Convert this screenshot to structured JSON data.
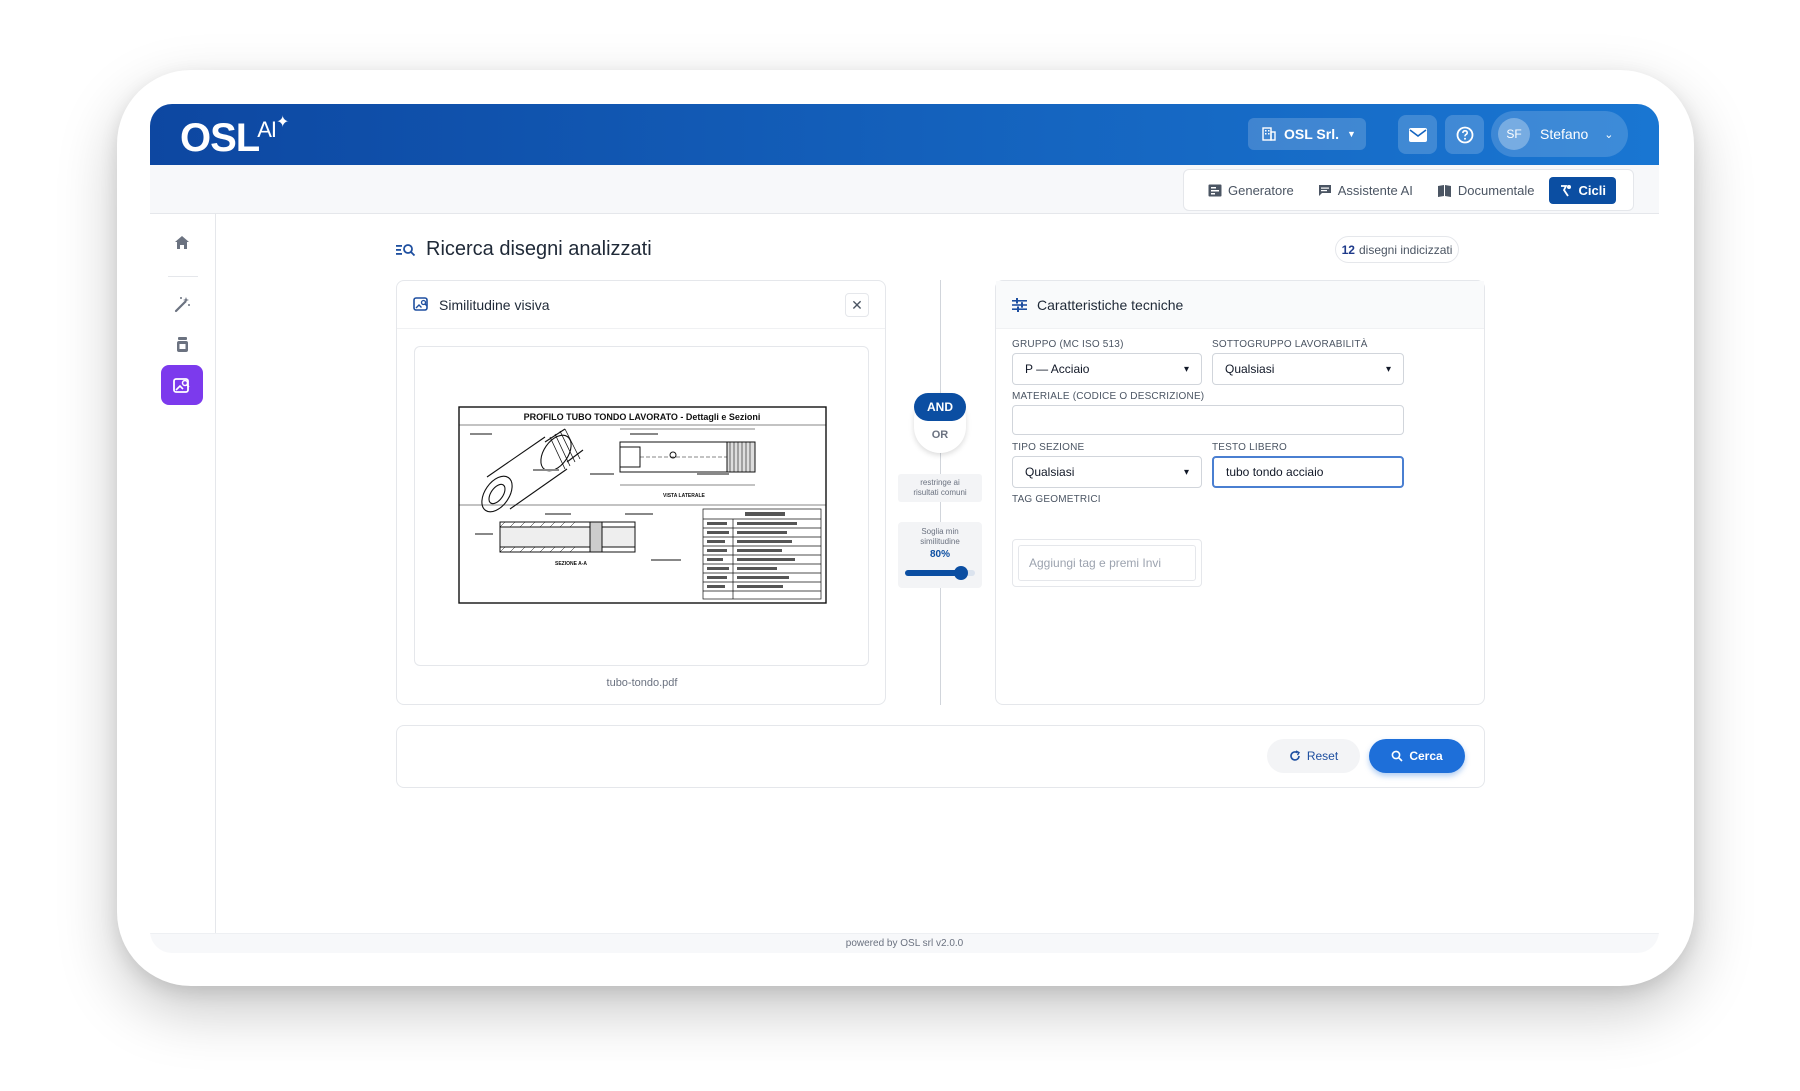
{
  "app": {
    "logo_text": "OSL",
    "logo_ai": "AI"
  },
  "header": {
    "company": "OSL Srl.",
    "user_initials": "SF",
    "user_name": "Stefano"
  },
  "subnav": {
    "items": [
      {
        "label": "Generatore",
        "icon": "generator-icon"
      },
      {
        "label": "Assistente AI",
        "icon": "chat-icon"
      },
      {
        "label": "Documentale",
        "icon": "book-icon"
      },
      {
        "label": "Cicli",
        "icon": "lathe-icon",
        "active": true
      }
    ]
  },
  "sidebar": {
    "items": [
      {
        "icon": "home-icon"
      },
      {
        "icon": "magic-wand-icon"
      },
      {
        "icon": "jar-icon"
      },
      {
        "icon": "image-search-icon",
        "active": true
      }
    ]
  },
  "page": {
    "title": "Ricerca disegni analizzati",
    "index_count": "12",
    "index_label": "disegni indicizzati"
  },
  "visual": {
    "title": "Similitudine visiva",
    "filename": "tubo-tondo.pdf",
    "drawing_title": "PROFILO TUBO TONDO LAVORATO - Dettagli e Sezioni"
  },
  "connector": {
    "and_label": "AND",
    "or_label": "OR",
    "restrict_line1": "restringe ai",
    "restrict_line2": "risultati comuni",
    "threshold_line1": "Soglia min",
    "threshold_line2": "similitudine",
    "threshold_value": "80%",
    "threshold_fraction": 0.8
  },
  "tech": {
    "title": "Caratteristiche tecniche",
    "group_label": "Gruppo (MC ISO 513)",
    "group_value": "P — Acciaio",
    "subgroup_label": "Sottogruppo lavorabilità",
    "subgroup_value": "Qualsiasi",
    "material_label": "Materiale (codice o descrizione)",
    "material_value": "",
    "section_label": "Tipo sezione",
    "section_value": "Qualsiasi",
    "freetext_label": "Testo libero",
    "freetext_value": "tubo tondo acciaio",
    "tags_label": "Tag geometrici",
    "tags_placeholder": "Aggiungi tag e premi Invi"
  },
  "actions": {
    "reset": "Reset",
    "search": "Cerca"
  },
  "footer": {
    "text": "powered by OSL srl v2.0.0"
  },
  "colors": {
    "brand_blue": "#0b4ea2",
    "accent_purple": "#7c3aed",
    "search_blue": "#1e6fd9"
  }
}
